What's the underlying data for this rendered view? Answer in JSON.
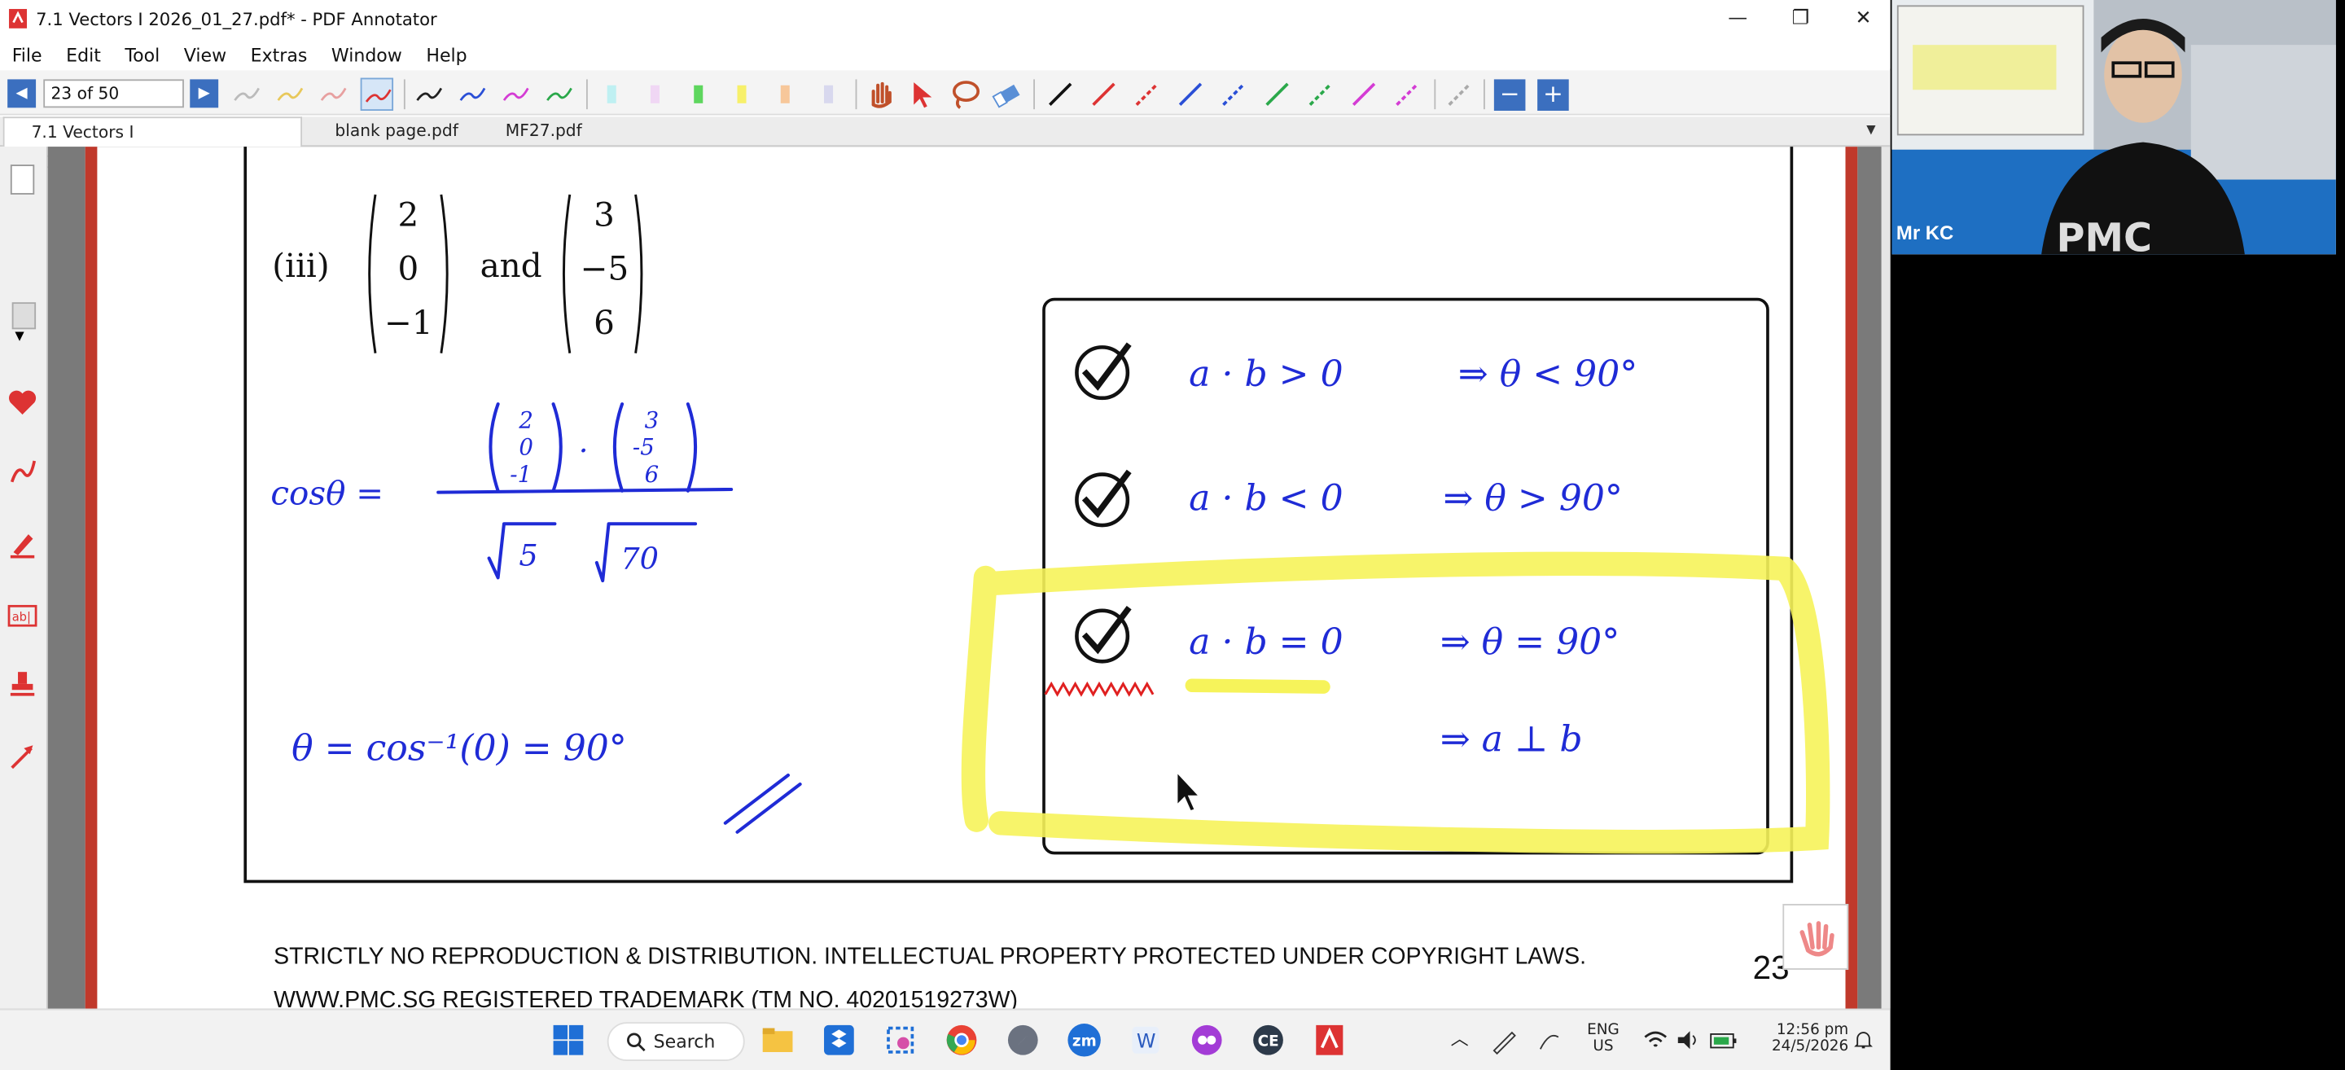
{
  "window": {
    "title": "7.1 Vectors I 2026_01_27.pdf* - PDF Annotator",
    "minimize": "—",
    "maximize": "❐",
    "close": "✕"
  },
  "menu": {
    "items": [
      "File",
      "Edit",
      "Tool",
      "View",
      "Extras",
      "Window",
      "Help"
    ]
  },
  "toolbar": {
    "page_indicator": "23 of 50",
    "prev_icon": "◀",
    "next_icon": "▶",
    "zoom_out": "−",
    "zoom_in": "+"
  },
  "tabs": [
    {
      "label": "7.1 Vectors I 2026_01_27.pdf*",
      "close": "✕"
    },
    {
      "label": "blank page.pdf"
    },
    {
      "label": "MF27.pdf"
    }
  ],
  "document": {
    "part_label": "(iii)",
    "vector_a": [
      "2",
      "0",
      "−1"
    ],
    "and_word": "and",
    "vector_b": [
      "3",
      "−5",
      "6"
    ],
    "footer_line1": "STRICTLY NO REPRODUCTION & DISTRIBUTION. INTELLECTUAL PROPERTY PROTECTED UNDER COPYRIGHT LAWS.",
    "footer_line2": "WWW.PMC.SG REGISTERED TRADEMARK (TM NO. 40201519273W)",
    "page_number": "23"
  },
  "handwriting": {
    "cos_label": "cosθ =",
    "num_a": [
      "2",
      "0",
      "-1"
    ],
    "num_b": [
      "3",
      "-5",
      "6"
    ],
    "dot": "·",
    "den_a": "5",
    "den_b": "70",
    "result": "θ = cos⁻¹(0) = 90°",
    "rule1_lhs": "a · b > 0",
    "rule1_rhs": "⇒ θ < 90°",
    "rule2_lhs": "a · b < 0",
    "rule2_rhs": "⇒ θ > 90°",
    "rule3_lhs": "a · b = 0",
    "rule3_rhs": "⇒ θ = 90°",
    "rule4_rhs": "⇒ a ⊥ b"
  },
  "taskbar": {
    "search_label": "Search",
    "lang_top": "ENG",
    "lang_bottom": "US",
    "time": "12:56 pm",
    "date": "24/5/2026"
  },
  "webcam": {
    "participant_name": "Mr KC"
  },
  "colors": {
    "ink_blue": "#1f2bd6",
    "highlight_yellow": "#f6f35a",
    "page_border_red": "#c0392b",
    "nav_blue": "#3b6fbf"
  }
}
